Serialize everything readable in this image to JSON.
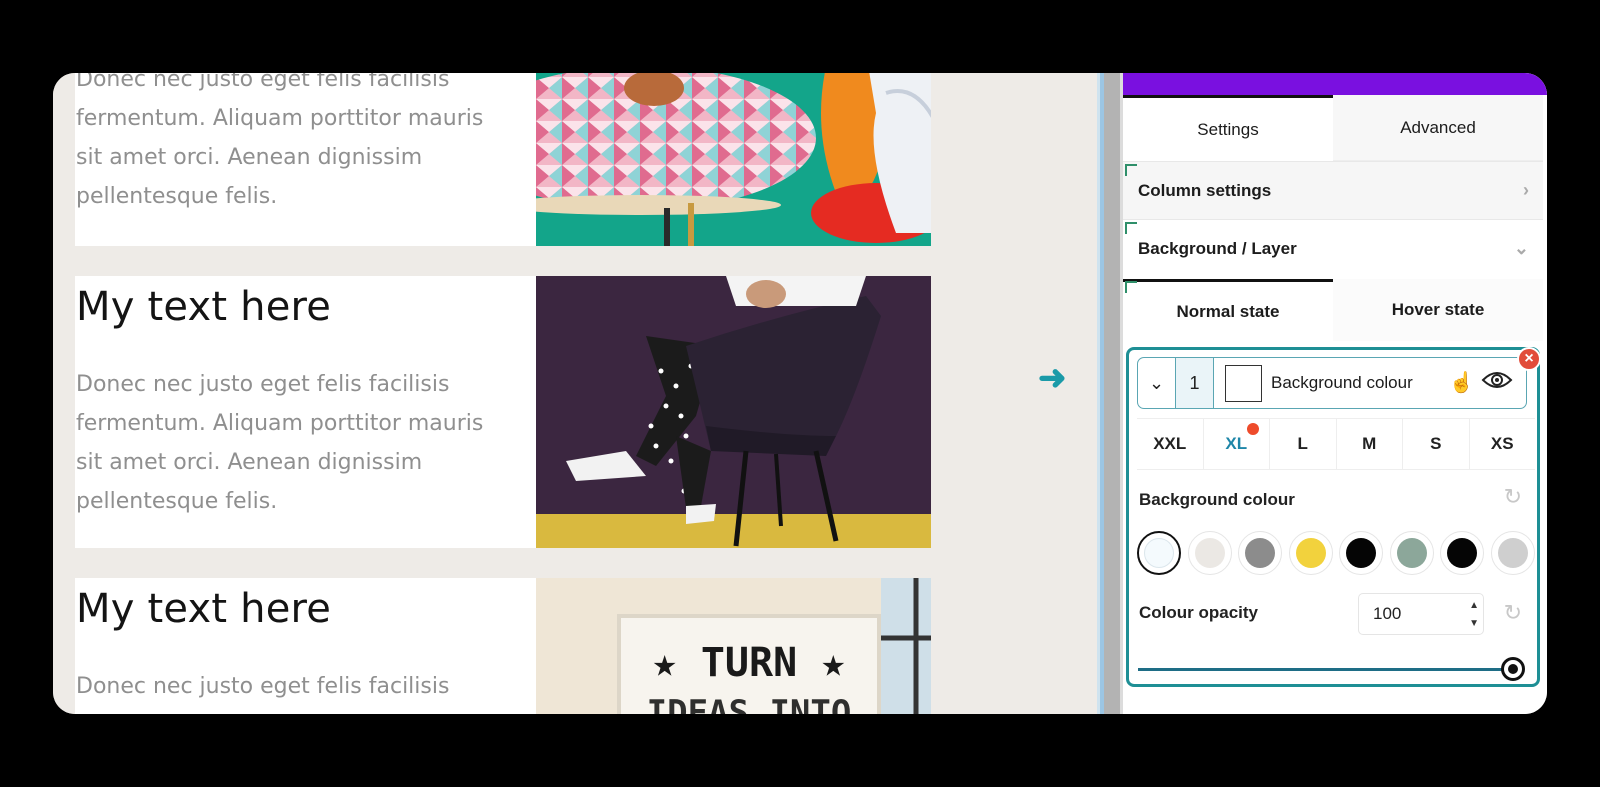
{
  "canvas": {
    "cards": [
      {
        "heading": "",
        "body": [
          "Donec nec justo eget felis facilisis",
          "fermentum. Aliquam porttitor mauris",
          "sit amet orci. Aenean dignissim",
          "pellentesque felis."
        ]
      },
      {
        "heading": "My text here",
        "body": [
          "Donec nec justo eget felis facilisis",
          "fermentum. Aliquam porttitor mauris",
          "sit amet orci. Aenean dignissim",
          "pellentesque felis."
        ]
      },
      {
        "heading": "My text here",
        "body": [
          "Donec nec justo eget felis facilisis"
        ],
        "image_sign": "★ TURN ★"
      }
    ],
    "arrow_icon": "arrow-right-icon"
  },
  "panel": {
    "tabs": {
      "settings": "Settings",
      "advanced": "Advanced"
    },
    "column_settings": "Column settings",
    "background_layer": "Background / Layer",
    "state_tabs": {
      "normal": "Normal state",
      "hover": "Hover state"
    },
    "layer": {
      "index": "1",
      "label": "Background colour"
    },
    "breakpoints": [
      "XXL",
      "XL",
      "L",
      "M",
      "S",
      "XS"
    ],
    "active_breakpoint": "XL",
    "background_colour_label": "Background colour",
    "swatches": [
      "#f4fafd",
      "#ebe8e4",
      "#8c8c8c",
      "#f2d23d",
      "#050505",
      "#8ca79a",
      "#050505",
      "#cfcfcf"
    ],
    "colour_opacity_label": "Colour opacity",
    "colour_opacity_value": "100",
    "opacity_slider_fraction": 1.0
  },
  "colors": {
    "accent": "#1e8f95",
    "purple": "#7a10e0",
    "active_bp": "#1e86a8"
  }
}
